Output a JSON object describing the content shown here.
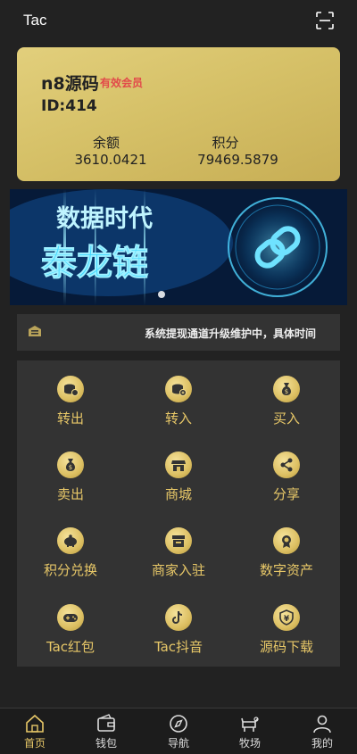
{
  "header": {
    "title": "Tac",
    "right_icon": "scan-icon"
  },
  "account": {
    "name": "n8源码",
    "member_badge": "有效会员",
    "id_text": "ID:414",
    "balance_label": "余额",
    "balance_value": "3610.0421",
    "points_label": "积分",
    "points_value": "79469.5879"
  },
  "banner": {
    "headline": "数据时代",
    "subheadline": "泰龙链",
    "dots": 1
  },
  "notice": {
    "icon": "announcement-icon",
    "text": "系统提现通道升级维护中，具体时间"
  },
  "menu": [
    {
      "label": "转出",
      "icon": "transfer-out-icon"
    },
    {
      "label": "转入",
      "icon": "transfer-in-icon"
    },
    {
      "label": "买入",
      "icon": "money-bag-icon"
    },
    {
      "label": "卖出",
      "icon": "sell-bag-icon"
    },
    {
      "label": "商城",
      "icon": "shop-icon"
    },
    {
      "label": "分享",
      "icon": "share-icon"
    },
    {
      "label": "积分兑换",
      "icon": "piggy-bank-icon"
    },
    {
      "label": "商家入驻",
      "icon": "store-icon"
    },
    {
      "label": "数字资产",
      "icon": "medal-icon"
    },
    {
      "label": "Tac红包",
      "icon": "gamepad-icon"
    },
    {
      "label": "Tac抖音",
      "icon": "tiktok-icon"
    },
    {
      "label": "源码下载",
      "icon": "yen-shield-icon"
    }
  ],
  "tabbar": [
    {
      "label": "首页",
      "icon": "home-icon",
      "active": true
    },
    {
      "label": "钱包",
      "icon": "wallet-icon",
      "active": false
    },
    {
      "label": "导航",
      "icon": "compass-icon",
      "active": false
    },
    {
      "label": "牧场",
      "icon": "ranch-icon",
      "active": false
    },
    {
      "label": "我的",
      "icon": "user-icon",
      "active": false
    }
  ],
  "colors": {
    "background": "#222222",
    "card_gold": "#d6c168",
    "accent": "#e8c868",
    "badge_red": "#e24a4a"
  }
}
